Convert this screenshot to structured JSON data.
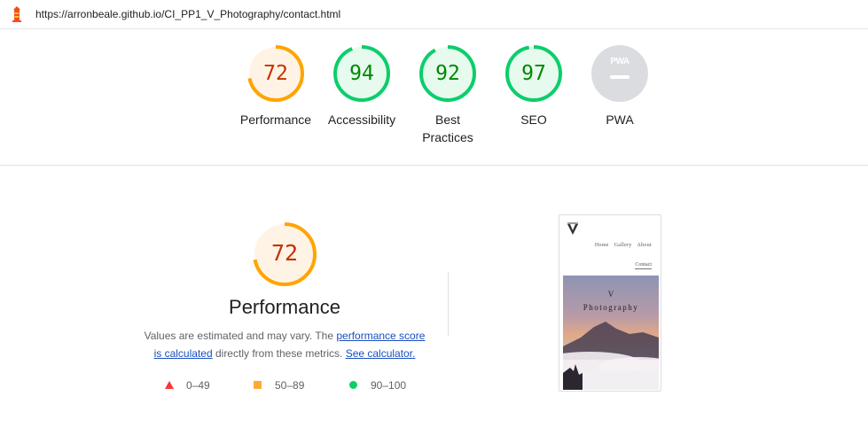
{
  "address_bar": {
    "url": "https://arronbeale.github.io/CI_PP1_V_Photography/contact.html",
    "logo_icon": "lighthouse-icon"
  },
  "scores": [
    {
      "label": "Performance",
      "value": "72",
      "fraction": 0.72,
      "color": "#ffa400",
      "text_color": "#c33300",
      "bg": "#fff3e6"
    },
    {
      "label": "Accessibility",
      "value": "94",
      "fraction": 0.94,
      "color": "#0cce6b",
      "text_color": "#008800",
      "bg": "#e6faee"
    },
    {
      "label": "Best Practices",
      "label_line1": "Best",
      "label_line2": "Practices",
      "value": "92",
      "fraction": 0.92,
      "color": "#0cce6b",
      "text_color": "#008800",
      "bg": "#e6faee"
    },
    {
      "label": "SEO",
      "value": "97",
      "fraction": 0.97,
      "color": "#0cce6b",
      "text_color": "#008800",
      "bg": "#e6faee"
    },
    {
      "label": "PWA",
      "badge_text": "PWA",
      "color": "#dadce0"
    }
  ],
  "performance": {
    "value": "72",
    "fraction": 0.72,
    "title": "Performance",
    "desc_prefix": "Values are estimated and may vary. The ",
    "link_score": "performance score",
    "link_calc": "is calculated",
    "desc_mid": " directly from these metrics. ",
    "link_calculator": "See calculator.",
    "desc_suffix": ""
  },
  "legend": [
    {
      "range": "0–49",
      "shape": "triangle",
      "color": "#ff3333"
    },
    {
      "range": "50–89",
      "shape": "square",
      "color": "#ffaa33"
    },
    {
      "range": "90–100",
      "shape": "circle",
      "color": "#0cce6b"
    }
  ],
  "screenshot": {
    "nav": [
      "Home",
      "Gallery",
      "About"
    ],
    "nav_active": "Contact",
    "hero_line1": "V",
    "hero_line2": "Photography"
  }
}
